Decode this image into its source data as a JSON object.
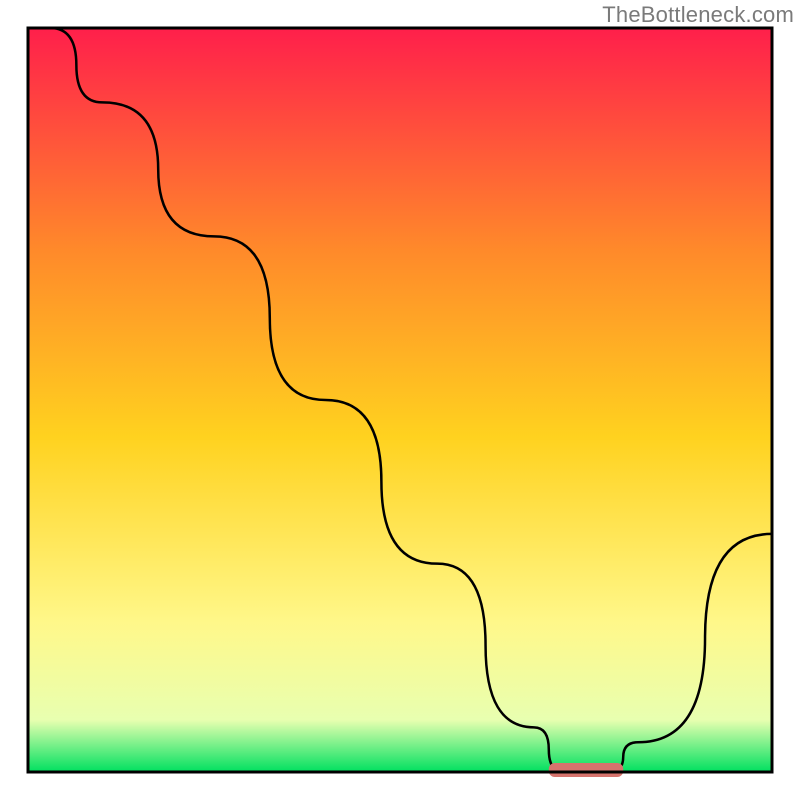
{
  "watermark": "TheBottleneck.com",
  "chart_data": {
    "type": "line",
    "title": "",
    "xlabel": "",
    "ylabel": "",
    "xlim": [
      0,
      100
    ],
    "ylim": [
      0,
      100
    ],
    "grid": false,
    "series": [
      {
        "name": "bottleneck-curve",
        "x": [
          3,
          10,
          25,
          40,
          55,
          68,
          72,
          78,
          82,
          100
        ],
        "y": [
          100,
          90,
          72,
          50,
          28,
          6,
          0,
          0,
          4,
          32
        ]
      }
    ],
    "optimal_marker": {
      "x_start": 70,
      "x_end": 80,
      "y": 0,
      "color": "#d6736d"
    },
    "background_gradient": {
      "top": "#ff1f4b",
      "mid_upper": "#ff8a2a",
      "mid": "#ffd21f",
      "mid_lower": "#fff88a",
      "low": "#e8ffb0",
      "bottom": "#00e060"
    },
    "frame": {
      "stroke": "#000000",
      "width": 3
    },
    "line_style": {
      "stroke": "#000000",
      "width": 2.5
    }
  }
}
